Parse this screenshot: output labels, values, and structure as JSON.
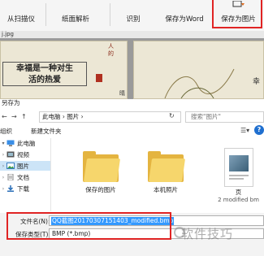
{
  "toolbar": {
    "scan_label": "从扫描仪",
    "layout_label": "纸面解析",
    "recognize_label": "识别",
    "save_word_label": "保存为Word",
    "save_image_label": "保存为图片"
  },
  "viewer": {
    "file_tab": "j.jpg",
    "poem_title_line1": "幸福是一种对生",
    "poem_title_line2": "活的热爱",
    "vertical_text_1": "人的",
    "vertical_text_2": "晴",
    "right_page_char": "幸"
  },
  "dialog": {
    "title": "另存为",
    "address_path": "此电脑  ›  图片  ›",
    "search_placeholder": "搜索\"图片\"",
    "organize_label": "组织",
    "new_folder_label": "新建文件夹",
    "nav": [
      {
        "label": "此电脑"
      },
      {
        "label": "视频"
      },
      {
        "label": "图片"
      },
      {
        "label": "文档"
      },
      {
        "label": "下载"
      }
    ],
    "files": [
      {
        "label": "保存的图片"
      },
      {
        "label": "本机照片"
      },
      {
        "label": "页",
        "sub": "2 modified bm"
      }
    ],
    "filename_label": "文件名(N):",
    "filename_value": "QQ截图20170307151403_modified.bmp",
    "filetype_label": "保存类型(T):",
    "filetype_value": "BMP (*.bmp)",
    "watermark": "软件技巧"
  },
  "colors": {
    "highlight_red": "#e02424",
    "selection_blue": "#3399ff",
    "folder_yellow": "#f6d66c"
  }
}
